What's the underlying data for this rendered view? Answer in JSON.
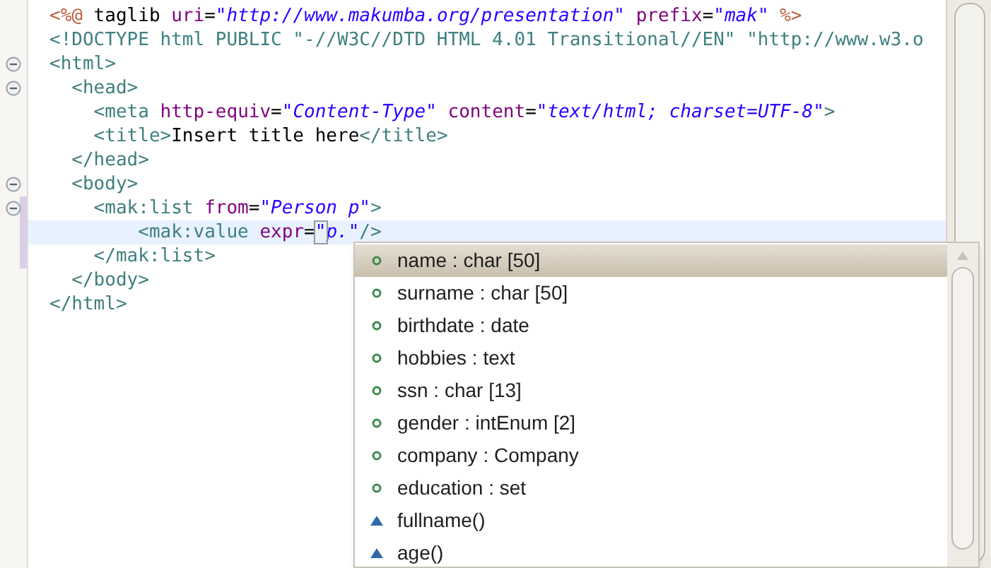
{
  "editor": {
    "lines": [
      {
        "fold": false,
        "current": false,
        "changed": false,
        "tokens": [
          {
            "kind": "directive",
            "text": "<%@"
          },
          {
            "kind": "text",
            "text": " taglib "
          },
          {
            "kind": "attr",
            "text": "uri"
          },
          {
            "kind": "text",
            "text": "="
          },
          {
            "kind": "value",
            "text": "\"http://www.makumba.org/presentation\""
          },
          {
            "kind": "attr",
            "text": " prefix"
          },
          {
            "kind": "text",
            "text": "="
          },
          {
            "kind": "value",
            "text": "\"mak\""
          },
          {
            "kind": "directive",
            "text": " %>"
          }
        ]
      },
      {
        "fold": false,
        "current": false,
        "changed": false,
        "tokens": [
          {
            "kind": "doctype",
            "text": "<!DOCTYPE html PUBLIC \"-//W3C//DTD HTML 4.01 Transitional//EN\" \"http://www.w3.o"
          }
        ]
      },
      {
        "fold": true,
        "current": false,
        "changed": false,
        "tokens": [
          {
            "kind": "tag",
            "text": "<html>"
          }
        ]
      },
      {
        "fold": true,
        "current": false,
        "changed": false,
        "tokens": [
          {
            "kind": "tag",
            "text": "  <head>"
          }
        ]
      },
      {
        "fold": false,
        "current": false,
        "changed": false,
        "tokens": [
          {
            "kind": "tag",
            "text": "    <meta"
          },
          {
            "kind": "attr",
            "text": " http-equiv"
          },
          {
            "kind": "text",
            "text": "="
          },
          {
            "kind": "value",
            "text": "\"Content-Type\""
          },
          {
            "kind": "attr",
            "text": " content"
          },
          {
            "kind": "text",
            "text": "="
          },
          {
            "kind": "value",
            "text": "\"text/html; charset=UTF-8\""
          },
          {
            "kind": "tag",
            "text": ">"
          }
        ]
      },
      {
        "fold": false,
        "current": false,
        "changed": false,
        "tokens": [
          {
            "kind": "tag",
            "text": "    <title>"
          },
          {
            "kind": "text",
            "text": "Insert title here"
          },
          {
            "kind": "tag",
            "text": "</title>"
          }
        ]
      },
      {
        "fold": false,
        "current": false,
        "changed": false,
        "tokens": [
          {
            "kind": "tag",
            "text": "  </head>"
          }
        ]
      },
      {
        "fold": true,
        "current": false,
        "changed": false,
        "tokens": [
          {
            "kind": "tag",
            "text": "  <body>"
          }
        ]
      },
      {
        "fold": true,
        "current": false,
        "changed": true,
        "tokens": [
          {
            "kind": "tag",
            "text": "    <mak:list"
          },
          {
            "kind": "attr",
            "text": " from"
          },
          {
            "kind": "text",
            "text": "="
          },
          {
            "kind": "value",
            "text": "\"Person p\""
          },
          {
            "kind": "tag",
            "text": ">"
          }
        ]
      },
      {
        "fold": false,
        "current": true,
        "changed": true,
        "tokens": [
          {
            "kind": "tag",
            "text": "        <mak:value"
          },
          {
            "kind": "attr",
            "text": " expr"
          },
          {
            "kind": "text",
            "text": "="
          },
          {
            "kind": "match",
            "text": "\""
          },
          {
            "kind": "value",
            "text": "p.\""
          },
          {
            "kind": "tag",
            "text": "/>"
          }
        ]
      },
      {
        "fold": false,
        "current": false,
        "changed": true,
        "tokens": [
          {
            "kind": "tag",
            "text": "    </mak:list>"
          }
        ]
      },
      {
        "fold": false,
        "current": false,
        "changed": false,
        "tokens": [
          {
            "kind": "tag",
            "text": "  </body>"
          }
        ]
      },
      {
        "fold": false,
        "current": false,
        "changed": false,
        "tokens": [
          {
            "kind": "tag",
            "text": "</html>"
          }
        ]
      }
    ]
  },
  "completion": {
    "items": [
      {
        "kind": "field",
        "label": "name : char [50]",
        "selected": true
      },
      {
        "kind": "field",
        "label": "surname : char [50]",
        "selected": false
      },
      {
        "kind": "field",
        "label": "birthdate : date",
        "selected": false
      },
      {
        "kind": "field",
        "label": "hobbies : text",
        "selected": false
      },
      {
        "kind": "field",
        "label": "ssn : char [13]",
        "selected": false
      },
      {
        "kind": "field",
        "label": "gender : intEnum [2]",
        "selected": false
      },
      {
        "kind": "field",
        "label": "company : Company",
        "selected": false
      },
      {
        "kind": "field",
        "label": "education : set",
        "selected": false
      },
      {
        "kind": "method",
        "label": "fullname()",
        "selected": false
      },
      {
        "kind": "method",
        "label": "age()",
        "selected": false
      }
    ]
  }
}
